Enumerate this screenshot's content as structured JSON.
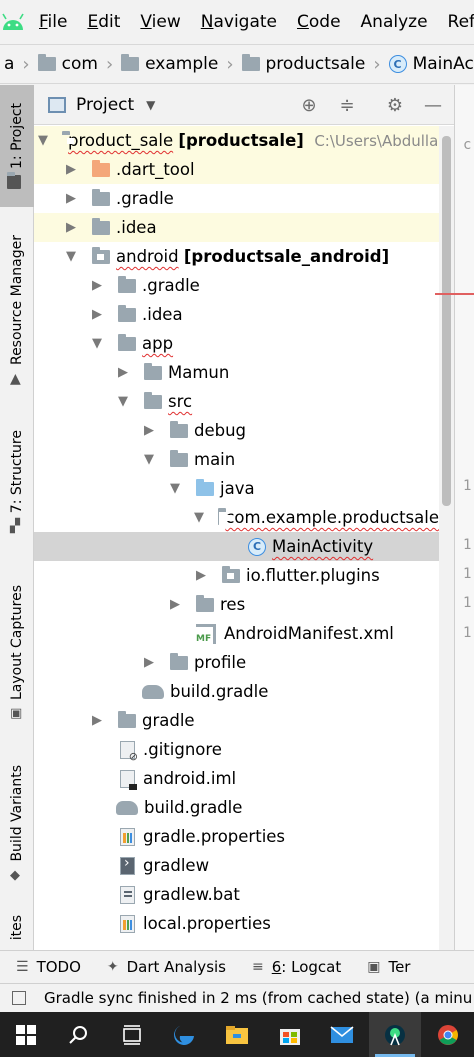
{
  "menubar": {
    "items": [
      {
        "mn": "F",
        "rest": "ile"
      },
      {
        "mn": "E",
        "rest": "dit"
      },
      {
        "mn": "V",
        "rest": "iew"
      },
      {
        "mn": "N",
        "rest": "avigate"
      },
      {
        "mn": "C",
        "rest": "ode"
      },
      {
        "mn": "",
        "rest": "Analyze"
      },
      {
        "mn": "",
        "rest": "Refact"
      }
    ]
  },
  "breadcrumb": {
    "first": "a",
    "c1": "com",
    "c2": "example",
    "c3": "productsale",
    "c4": "MainActivity"
  },
  "leftstrip": {
    "project": "1: Project",
    "resource": "Resource Manager",
    "structure": "7: Structure",
    "captures": "Layout Captures",
    "variants": "Build Variants",
    "favorites": "ites"
  },
  "panel": {
    "title": "Project"
  },
  "tree": {
    "r0_name": "product_sale",
    "r0_module": "[productsale]",
    "r0_path": "C:\\Users\\Abdullah",
    "r1": ".dart_tool",
    "r2": ".gradle",
    "r3": ".idea",
    "r4_name": "android",
    "r4_module": "[productsale_android]",
    "r5": ".gradle",
    "r6": ".idea",
    "r7": "app",
    "r8": "Mamun",
    "r9": "src",
    "r10": "debug",
    "r11": "main",
    "r12": "java",
    "r13": "com.example.productsale",
    "r14": "MainActivity",
    "r15": "io.flutter.plugins",
    "r16": "res",
    "r17": "AndroidManifest.xml",
    "r18": "profile",
    "r19": "build.gradle",
    "r20": "gradle",
    "r21": ".gitignore",
    "r22": "android.iml",
    "r23": "build.gradle",
    "r24": "gradle.properties",
    "r25": "gradlew",
    "r26": "gradlew.bat",
    "r27": "local.properties",
    "mf_badge": "MF",
    "class_badge": "C"
  },
  "editor": {
    "lines": [
      "c",
      "1",
      "1",
      "1",
      "1",
      "1"
    ]
  },
  "tooltabs": {
    "todo": "TODO",
    "dart_analysis": "Dart Analysis",
    "logcat_mn": "6",
    "logcat_rest": ": Logcat",
    "terminal": "Ter"
  },
  "status": {
    "message": "Gradle sync finished in 2 ms (from cached state) (a minu"
  },
  "colors": {
    "android_green": "#3ddc84",
    "selected_row": "#d4d4d4",
    "highlight_row": "#fdfbe0",
    "folder_blue": "#8ec2e8",
    "folder_orange": "#f4a77a"
  }
}
